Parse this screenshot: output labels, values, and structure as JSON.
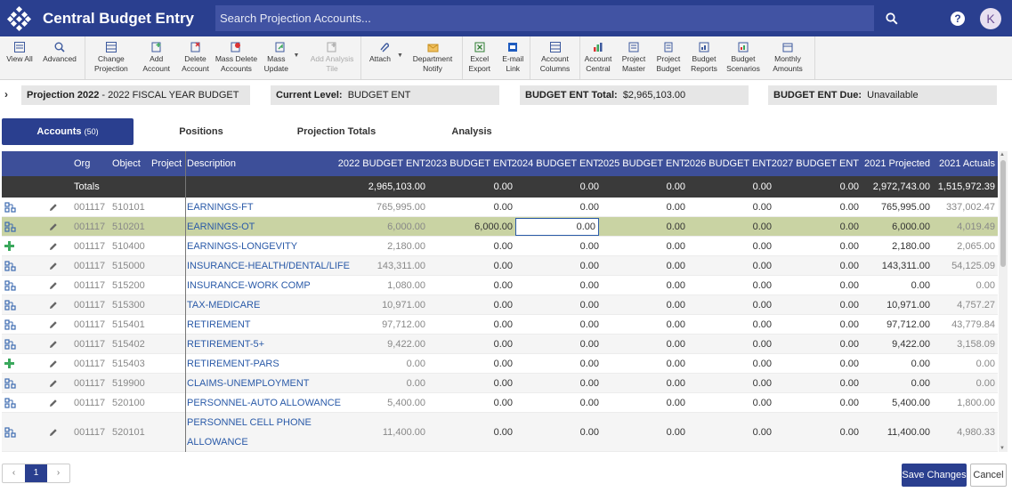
{
  "app": {
    "title": "Central Budget Entry",
    "search_placeholder": "Search Projection Accounts...",
    "avatar_initial": "K",
    "help_label": "?"
  },
  "toolbar": {
    "view_all": "View All",
    "advanced": "Advanced",
    "change_projection": "Change Projection",
    "add_account": "Add Account",
    "delete_account": "Delete Account",
    "mass_delete_accounts": "Mass Delete Accounts",
    "mass_update": "Mass Update",
    "add_analysis_tile": "Add Analysis Tile",
    "attach": "Attach",
    "department_notify": "Department Notify",
    "excel_export": "Excel Export",
    "email_link": "E-mail Link",
    "account_columns": "Account Columns",
    "account_central": "Account Central",
    "project_master": "Project Master",
    "project_budget": "Project Budget",
    "budget_reports": "Budget Reports",
    "budget_scenarios": "Budget Scenarios",
    "monthly_amounts": "Monthly Amounts"
  },
  "info": {
    "projection_label": "Projection 2022",
    "projection_value": " - 2022 FISCAL YEAR BUDGET",
    "level_label": "Current Level:",
    "level_value": "BUDGET ENT",
    "total_label": "BUDGET ENT Total:",
    "total_value": "$2,965,103.00",
    "due_label": "BUDGET ENT Due:",
    "due_value": "Unavailable"
  },
  "tabs": {
    "accounts": "Accounts",
    "accounts_count": "(50)",
    "positions": "Positions",
    "projection_totals": "Projection Totals",
    "analysis": "Analysis"
  },
  "grid": {
    "headers": {
      "org": "Org",
      "object": "Object",
      "project": "Project",
      "description": "Description",
      "c2022": "2022 BUDGET ENT",
      "c2023": "2023 BUDGET ENT",
      "c2024": "2024 BUDGET ENT",
      "c2025": "2025 BUDGET ENT",
      "c2026": "2026 BUDGET ENT",
      "c2027": "2027 BUDGET ENT",
      "proj2021": "2021 Projected",
      "act2021": "2021 Actuals"
    },
    "totals": {
      "label": "Totals",
      "c2022": "2,965,103.00",
      "c2023": "0.00",
      "c2024": "0.00",
      "c2025": "0.00",
      "c2026": "0.00",
      "c2027": "0.00",
      "proj2021": "2,972,743.00",
      "act2021": "1,515,972.39"
    },
    "rows": [
      {
        "icon": "link",
        "org": "001117",
        "object": "510101",
        "desc": "EARNINGS-FT",
        "c2022": "765,995.00",
        "c2023": "0.00",
        "c2024": "0.00",
        "c2025": "0.00",
        "c2026": "0.00",
        "c2027": "0.00",
        "proj2021": "765,995.00",
        "act2021": "337,002.47"
      },
      {
        "icon": "link",
        "org": "001117",
        "object": "510201",
        "desc": "EARNINGS-OT",
        "c2022": "6,000.00",
        "c2023": "6,000.00",
        "c2024": "0.00",
        "c2025": "0.00",
        "c2026": "0.00",
        "c2027": "0.00",
        "proj2021": "6,000.00",
        "act2021": "4,019.49"
      },
      {
        "icon": "plus",
        "org": "001117",
        "object": "510400",
        "desc": "EARNINGS-LONGEVITY",
        "c2022": "2,180.00",
        "c2023": "0.00",
        "c2024": "0.00",
        "c2025": "0.00",
        "c2026": "0.00",
        "c2027": "0.00",
        "proj2021": "2,180.00",
        "act2021": "2,065.00"
      },
      {
        "icon": "link",
        "org": "001117",
        "object": "515000",
        "desc": "INSURANCE-HEALTH/DENTAL/LIFE",
        "c2022": "143,311.00",
        "c2023": "0.00",
        "c2024": "0.00",
        "c2025": "0.00",
        "c2026": "0.00",
        "c2027": "0.00",
        "proj2021": "143,311.00",
        "act2021": "54,125.09"
      },
      {
        "icon": "link",
        "org": "001117",
        "object": "515200",
        "desc": "INSURANCE-WORK COMP",
        "c2022": "1,080.00",
        "c2023": "0.00",
        "c2024": "0.00",
        "c2025": "0.00",
        "c2026": "0.00",
        "c2027": "0.00",
        "proj2021": "0.00",
        "act2021": "0.00"
      },
      {
        "icon": "link",
        "org": "001117",
        "object": "515300",
        "desc": "TAX-MEDICARE",
        "c2022": "10,971.00",
        "c2023": "0.00",
        "c2024": "0.00",
        "c2025": "0.00",
        "c2026": "0.00",
        "c2027": "0.00",
        "proj2021": "10,971.00",
        "act2021": "4,757.27"
      },
      {
        "icon": "link",
        "org": "001117",
        "object": "515401",
        "desc": "RETIREMENT",
        "c2022": "97,712.00",
        "c2023": "0.00",
        "c2024": "0.00",
        "c2025": "0.00",
        "c2026": "0.00",
        "c2027": "0.00",
        "proj2021": "97,712.00",
        "act2021": "43,779.84"
      },
      {
        "icon": "link",
        "org": "001117",
        "object": "515402",
        "desc": "RETIREMENT-5+",
        "c2022": "9,422.00",
        "c2023": "0.00",
        "c2024": "0.00",
        "c2025": "0.00",
        "c2026": "0.00",
        "c2027": "0.00",
        "proj2021": "9,422.00",
        "act2021": "3,158.09"
      },
      {
        "icon": "plus",
        "org": "001117",
        "object": "515403",
        "desc": "RETIREMENT-PARS",
        "c2022": "0.00",
        "c2023": "0.00",
        "c2024": "0.00",
        "c2025": "0.00",
        "c2026": "0.00",
        "c2027": "0.00",
        "proj2021": "0.00",
        "act2021": "0.00"
      },
      {
        "icon": "link",
        "org": "001117",
        "object": "519900",
        "desc": "CLAIMS-UNEMPLOYMENT",
        "c2022": "0.00",
        "c2023": "0.00",
        "c2024": "0.00",
        "c2025": "0.00",
        "c2026": "0.00",
        "c2027": "0.00",
        "proj2021": "0.00",
        "act2021": "0.00"
      },
      {
        "icon": "link",
        "org": "001117",
        "object": "520100",
        "desc": "PERSONNEL-AUTO ALLOWANCE",
        "c2022": "5,400.00",
        "c2023": "0.00",
        "c2024": "0.00",
        "c2025": "0.00",
        "c2026": "0.00",
        "c2027": "0.00",
        "proj2021": "5,400.00",
        "act2021": "1,800.00"
      },
      {
        "icon": "link",
        "org": "001117",
        "object": "520101",
        "desc": "PERSONNEL CELL PHONE ALLOWANCE",
        "desc_line1": "PERSONNEL CELL PHONE",
        "desc_line2": "ALLOWANCE",
        "c2022": "11,400.00",
        "c2023": "0.00",
        "c2024": "0.00",
        "c2025": "0.00",
        "c2026": "0.00",
        "c2027": "0.00",
        "proj2021": "11,400.00",
        "act2021": "4,980.33"
      }
    ]
  },
  "pager": {
    "prev": "‹",
    "current": "1",
    "next": "›"
  },
  "footer": {
    "save": "Save Changes",
    "cancel": "Cancel"
  },
  "colors": {
    "primary": "#2a3f8f",
    "selected_row": "#c9d3a3",
    "link": "#2a5aa8",
    "add_icon": "#3aa85c"
  }
}
